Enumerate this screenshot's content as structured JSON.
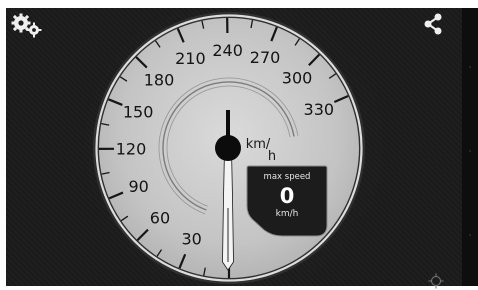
{
  "toolbar": {
    "settings_icon": "gears-icon",
    "share_icon": "share-icon"
  },
  "gauge": {
    "scale_labels": [
      "30",
      "60",
      "90",
      "120",
      "150",
      "180",
      "210",
      "240",
      "270",
      "300",
      "330"
    ],
    "unit_label": "km/h",
    "unit_top": "km/",
    "unit_bottom": "h",
    "needle_value": 0,
    "max_panel": {
      "title": "max speed",
      "value": "0",
      "unit": "km/h"
    }
  },
  "colors": {
    "background": "#1b1b1b",
    "dial_face": "#c6c6c6",
    "bezel": "#2a2a2a",
    "text": "#141414",
    "needle": "#f4f4f4"
  },
  "footer": {
    "gps_icon": "gps-crosshair-icon"
  }
}
